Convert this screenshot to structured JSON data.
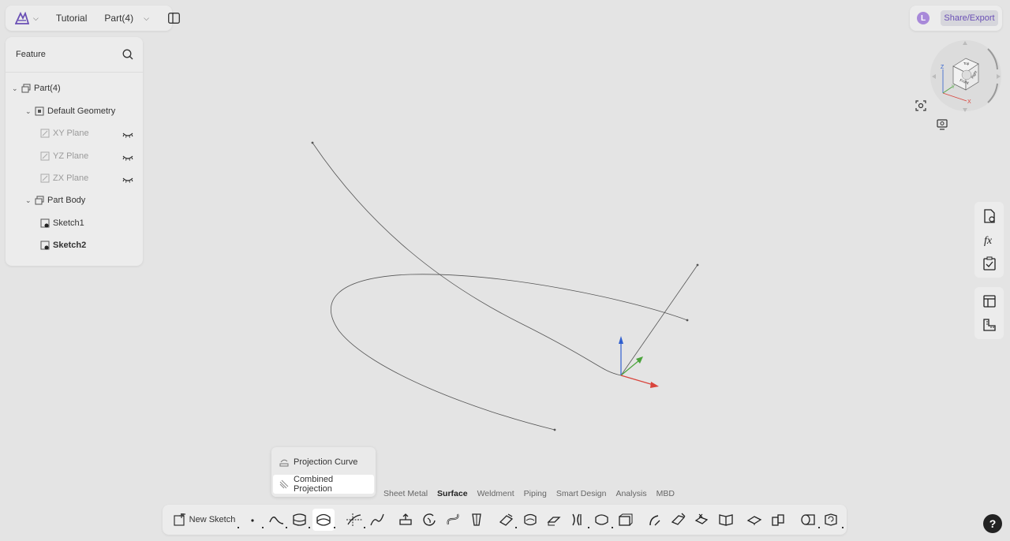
{
  "topbar": {
    "project": "Tutorial",
    "document": "Part(4)"
  },
  "user": {
    "avatar_letter": "L",
    "share_label": "Share/Export"
  },
  "feature_panel": {
    "title": "Feature",
    "tree": [
      {
        "label": "Part(4)",
        "level": 0,
        "expanded": true,
        "icon": "part-icon"
      },
      {
        "label": "Default Geometry",
        "level": 1,
        "expanded": true,
        "icon": "geometry-icon"
      },
      {
        "label": "XY Plane",
        "level": 2,
        "dim": true,
        "icon": "plane-icon",
        "hidden": true
      },
      {
        "label": "YZ Plane",
        "level": 2,
        "dim": true,
        "icon": "plane-icon",
        "hidden": true
      },
      {
        "label": "ZX Plane",
        "level": 2,
        "dim": true,
        "icon": "plane-icon",
        "hidden": true
      },
      {
        "label": "Part Body",
        "level": 1,
        "expanded": true,
        "icon": "body-icon"
      },
      {
        "label": "Sketch1",
        "level": 2,
        "icon": "sketch-icon"
      },
      {
        "label": "Sketch2",
        "level": 2,
        "bold": true,
        "icon": "sketch-icon"
      }
    ]
  },
  "view_cube": {
    "faces": [
      "Front",
      "Top",
      "Right"
    ],
    "axes": [
      "Z",
      "Y",
      "X"
    ]
  },
  "dropdown": {
    "items": [
      {
        "label": "Projection Curve",
        "icon": "projection-curve-icon",
        "active": false
      },
      {
        "label": "Combined Projection",
        "icon": "combined-projection-icon",
        "active": true
      }
    ]
  },
  "tabs": [
    {
      "label": "Sheet Metal",
      "active": false
    },
    {
      "label": "Surface",
      "active": true
    },
    {
      "label": "Weldment",
      "active": false
    },
    {
      "label": "Piping",
      "active": false
    },
    {
      "label": "Smart Design",
      "active": false
    },
    {
      "label": "Analysis",
      "active": false
    },
    {
      "label": "MBD",
      "active": false
    }
  ],
  "toolbar": {
    "new_sketch_label": "New Sketch"
  },
  "help": {
    "label": "?"
  },
  "colors": {
    "accent": "#6a4fb5",
    "axis_x": "#d9443c",
    "axis_y": "#4aa33a",
    "axis_z": "#2f5fcf"
  }
}
